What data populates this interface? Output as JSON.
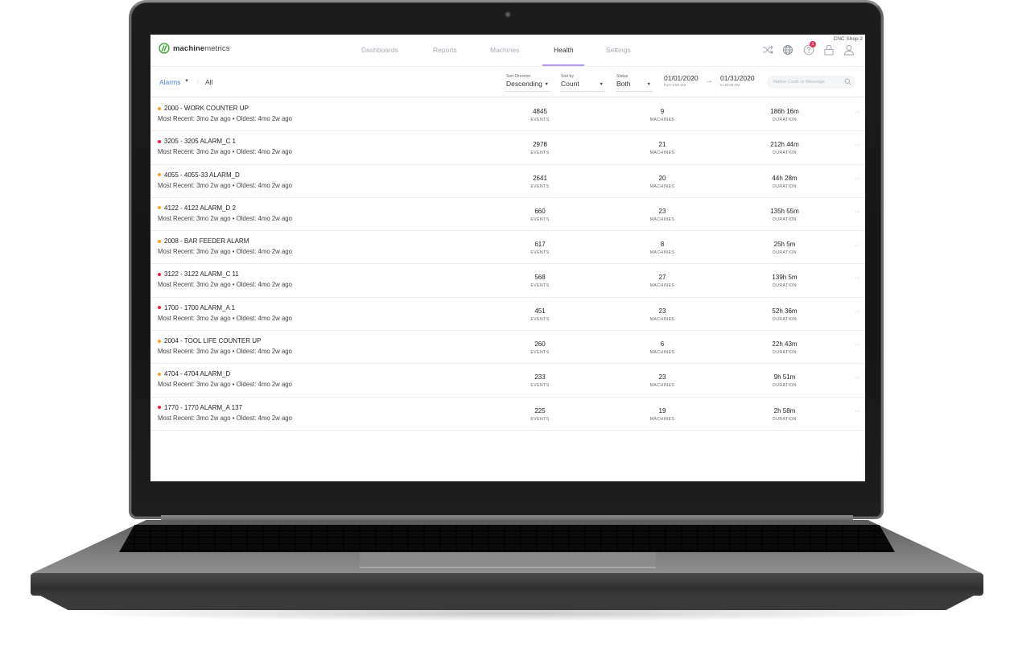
{
  "brand": {
    "name_bold": "machine",
    "name_light": "metrics",
    "accent_color": "#3aa935"
  },
  "nav": {
    "items": [
      {
        "label": "Dashboards",
        "active": false
      },
      {
        "label": "Reports",
        "active": false
      },
      {
        "label": "Machines",
        "active": false
      },
      {
        "label": "Health",
        "active": true
      },
      {
        "label": "Settings",
        "active": false
      }
    ],
    "active_underline_color": "#b79ce8",
    "shop_name": "CNC Shop 2",
    "icons": [
      "shuffle-icon",
      "globe-icon",
      "help-icon",
      "lock-icon",
      "user-icon"
    ],
    "help_badge": "1"
  },
  "filters": {
    "breadcrumb": {
      "section": "Alarms",
      "current": "All",
      "separator": "/"
    },
    "sort_direction": {
      "label": "Sort Direction",
      "value": "Descending"
    },
    "sort_by": {
      "label": "Sort by",
      "value": "Count"
    },
    "status": {
      "label": "Status",
      "value": "Both"
    },
    "date_from": {
      "date": "01/01/2020",
      "time": "from 9:00 AM"
    },
    "date_to": {
      "date": "01/31/2020",
      "time": "to 10:00 AM"
    },
    "search_placeholder": "Native Code or Message"
  },
  "labels": {
    "events": "EVENTS",
    "machines": "MACHINES",
    "duration": "DURATION",
    "more": "···"
  },
  "severity_colors": {
    "warning": "#f5a623",
    "critical": "#e8233a"
  },
  "alarms": [
    {
      "title": "2000 - WORK COUNTER UP",
      "severity": "warning",
      "recency": "Most Recent: 3mo 2w ago • Oldest: 4mo 2w ago",
      "events": "4845",
      "machines": "9",
      "duration": "186h 16m"
    },
    {
      "title": "3205 - 3205 ALARM_C 1",
      "severity": "critical",
      "recency": "Most Recent: 3mo 2w ago • Oldest: 4mo 2w ago",
      "events": "2978",
      "machines": "21",
      "duration": "212h 44m"
    },
    {
      "title": "4055 - 4055-33 ALARM_D",
      "severity": "warning",
      "recency": "Most Recent: 3mo 2w ago • Oldest: 4mo 2w ago",
      "events": "2641",
      "machines": "20",
      "duration": "44h 28m"
    },
    {
      "title": "4122 - 4122 ALARM_D 2",
      "severity": "warning",
      "recency": "Most Recent: 3mo 2w ago • Oldest: 4mo 2w ago",
      "events": "660",
      "machines": "23",
      "duration": "135h 55m"
    },
    {
      "title": "2008 - BAR FEEDER ALARM",
      "severity": "warning",
      "recency": "Most Recent: 3mo 2w ago • Oldest: 4mo 2w ago",
      "events": "617",
      "machines": "8",
      "duration": "25h 5m"
    },
    {
      "title": "3122 - 3122 ALARM_C 11",
      "severity": "critical",
      "recency": "Most Recent: 3mo 2w ago • Oldest: 4mo 2w ago",
      "events": "568",
      "machines": "27",
      "duration": "139h 5m"
    },
    {
      "title": "1700 - 1700 ALARM_A 1",
      "severity": "critical",
      "recency": "Most Recent: 3mo 2w ago • Oldest: 4mo 2w ago",
      "events": "451",
      "machines": "23",
      "duration": "52h 36m"
    },
    {
      "title": "2004 - TOOL LIFE COUNTER UP",
      "severity": "warning",
      "recency": "Most Recent: 3mo 2w ago • Oldest: 4mo 2w ago",
      "events": "260",
      "machines": "6",
      "duration": "22h 43m"
    },
    {
      "title": "4704 - 4704 ALARM_D",
      "severity": "warning",
      "recency": "Most Recent: 3mo 2w ago • Oldest: 4mo 2w ago",
      "events": "233",
      "machines": "23",
      "duration": "9h 51m"
    },
    {
      "title": "1770 - 1770 ALARM_A 137",
      "severity": "critical",
      "recency": "Most Recent: 3mo 2w ago • Oldest: 4mo 2w ago",
      "events": "225",
      "machines": "19",
      "duration": "2h 58m"
    }
  ]
}
